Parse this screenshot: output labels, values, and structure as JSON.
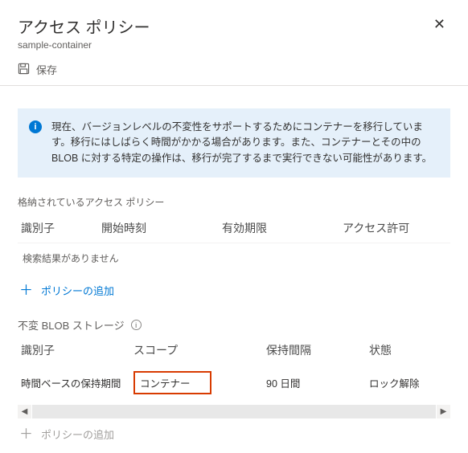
{
  "header": {
    "title": "アクセス ポリシー",
    "subtitle": "sample-container"
  },
  "toolbar": {
    "save_label": "保存"
  },
  "info": {
    "message": "現在、バージョンレベルの不変性をサポートするためにコンテナーを移行しています。移行にはしばらく時間がかかる場合があります。また、コンテナーとその中の BLOB に対する特定の操作は、移行が完了するまで実行できない可能性があります。"
  },
  "stored_policies": {
    "section_label": "格納されているアクセス ポリシー",
    "columns": {
      "identifier": "識別子",
      "start_time": "開始時刻",
      "expiry": "有効期限",
      "permissions": "アクセス許可"
    },
    "empty_message": "検索結果がありません",
    "add_label": "ポリシーの追加"
  },
  "immutable": {
    "section_label": "不変 BLOB ストレージ",
    "columns": {
      "identifier": "識別子",
      "scope": "スコープ",
      "retention": "保持間隔",
      "status": "状態"
    },
    "row": {
      "identifier": "時間ベースの保持期間",
      "scope": "コンテナー",
      "retention": "90 日間",
      "status": "ロック解除"
    },
    "add_label": "ポリシーの追加"
  }
}
